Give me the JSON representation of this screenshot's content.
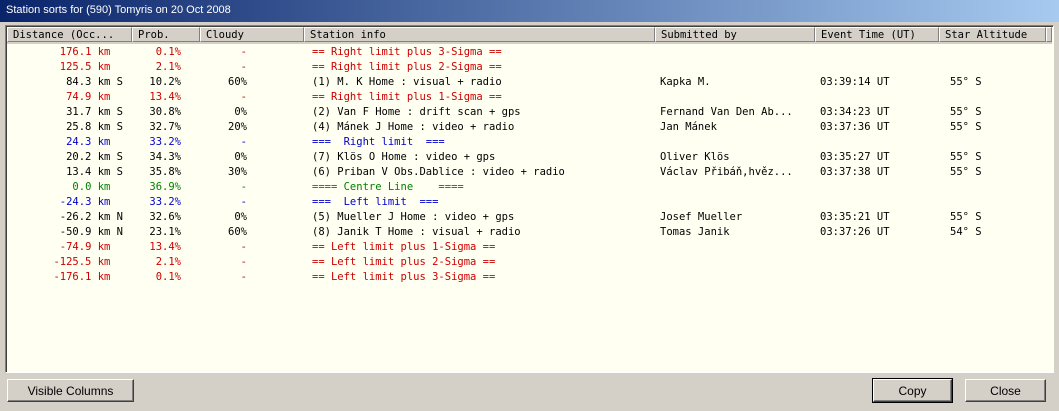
{
  "window": {
    "title": "Station sorts for (590) Tomyris on 20 Oct 2008"
  },
  "colors": {
    "red": "#cc0000",
    "blue": "#0000cc",
    "green": "#008000",
    "black": "#000000"
  },
  "columns": [
    "Distance (Occ...",
    "Prob.",
    "Cloudy",
    "Station info",
    "Submitted by",
    "Event Time (UT)",
    "Star Altitude"
  ],
  "rows": [
    {
      "color": "red",
      "cells": [
        "176.1 km  ",
        "0.1%",
        "-",
        "== Right limit plus 3-Sigma ==",
        "",
        "",
        ""
      ]
    },
    {
      "color": "red",
      "cells": [
        "125.5 km  ",
        "2.1%",
        "-",
        "== Right limit plus 2-Sigma ==",
        "",
        "",
        ""
      ]
    },
    {
      "color": "black",
      "cells": [
        "84.3 km S",
        "10.2%",
        "60%",
        "(1) M. K Home : visual + radio",
        "Kapka M.",
        "03:39:14 UT",
        "55° S"
      ]
    },
    {
      "color": "red",
      "cells": [
        "74.9 km  ",
        "13.4%",
        "-",
        "== Right limit plus 1-Sigma ==",
        "",
        "",
        ""
      ]
    },
    {
      "color": "black",
      "cells": [
        "31.7 km S",
        "30.8%",
        "0%",
        "(2) Van F Home : drift scan + gps",
        "Fernand Van Den Ab...",
        "03:34:23 UT",
        "55° S"
      ]
    },
    {
      "color": "black",
      "cells": [
        "25.8 km S",
        "32.7%",
        "20%",
        "(4) Mánek J Home : video + radio",
        "Jan Mánek",
        "03:37:36 UT",
        "55° S"
      ]
    },
    {
      "color": "blue",
      "cells": [
        "24.3 km  ",
        "33.2%",
        "-",
        "===  Right limit  ===",
        "",
        "",
        ""
      ]
    },
    {
      "color": "black",
      "cells": [
        "20.2 km S",
        "34.3%",
        "0%",
        "(7) Klös O Home : video + gps",
        "Oliver Klös",
        "03:35:27 UT",
        "55° S"
      ]
    },
    {
      "color": "black",
      "cells": [
        "13.4 km S",
        "35.8%",
        "30%",
        "(6) Priban V Obs.Dablice : video + radio",
        "Václav Přibáň,hvěz...",
        "03:37:38 UT",
        "55° S"
      ]
    },
    {
      "color": "green",
      "cells": [
        "0.0 km  ",
        "36.9%",
        "-",
        "==== Centre Line    ====",
        "",
        "",
        ""
      ]
    },
    {
      "color": "blue",
      "cells": [
        "-24.3 km  ",
        "33.2%",
        "-",
        "===  Left limit  ===",
        "",
        "",
        ""
      ]
    },
    {
      "color": "black",
      "cells": [
        "-26.2 km N",
        "32.6%",
        "0%",
        "(5) Mueller J Home : video + gps",
        "Josef Mueller",
        "03:35:21 UT",
        "55° S"
      ]
    },
    {
      "color": "black",
      "cells": [
        "-50.9 km N",
        "23.1%",
        "60%",
        "(8) Janik T Home : visual + radio",
        "Tomas Janik",
        "03:37:26 UT",
        "54° S"
      ]
    },
    {
      "color": "red",
      "cells": [
        "-74.9 km  ",
        "13.4%",
        "-",
        "== Left limit plus 1-Sigma ==",
        "",
        "",
        ""
      ]
    },
    {
      "color": "red",
      "cells": [
        "-125.5 km  ",
        "2.1%",
        "-",
        "== Left limit plus 2-Sigma ==",
        "",
        "",
        ""
      ]
    },
    {
      "color": "red",
      "cells": [
        "-176.1 km  ",
        "0.1%",
        "-",
        "== Left limit plus 3-Sigma ==",
        "",
        "",
        ""
      ]
    }
  ],
  "buttons": {
    "visible_columns": "Visible Columns",
    "copy": "Copy",
    "close": "Close"
  }
}
